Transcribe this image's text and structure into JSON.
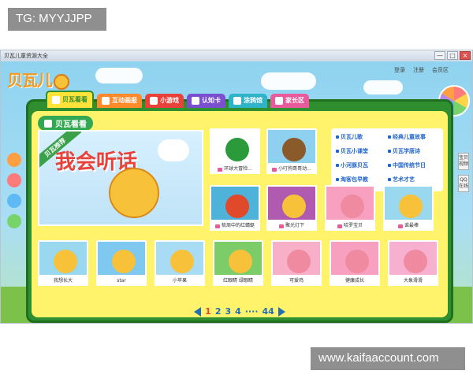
{
  "tags": {
    "top": "TG: MYYJJPP",
    "bottom": "www.kaifaaccount.com"
  },
  "window": {
    "title": "贝瓦儿童资源大全",
    "controls": [
      "—",
      "□",
      "×"
    ]
  },
  "header": {
    "logo_text": "贝瓦儿",
    "links": [
      "登录",
      "注册",
      "会员区"
    ]
  },
  "tabs": [
    {
      "label": "贝瓦看看",
      "color": "#2f8f2f"
    },
    {
      "label": "互动画报",
      "color": "#ff8a2a"
    },
    {
      "label": "小游戏",
      "color": "#e8423a"
    },
    {
      "label": "认知卡",
      "color": "#7a4fd0"
    },
    {
      "label": "涂鸦馆",
      "color": "#2eb3c9"
    },
    {
      "label": "家长区",
      "color": "#e85a9b"
    }
  ],
  "section_title": "贝瓦看看",
  "featured": {
    "ribbon": "贝瓦推荐",
    "headline": "我会听话"
  },
  "links": [
    "贝瓦儿歌",
    "经典儿童故事",
    "贝瓦小课堂",
    "贝瓦学唐诗",
    "小河豚贝瓦",
    "中国传统节日",
    "淘客包早教",
    "艺术才艺"
  ],
  "row1": [
    {
      "caption": "环球大冒险...",
      "bg": "#ffffff",
      "char": "#2a9a3a"
    },
    {
      "caption": "小叮狗哥哥动...",
      "bg": "#8ed0f0",
      "char": "#8b5a2b"
    }
  ],
  "row2": [
    {
      "caption": "梳周中的红蜻蜓",
      "bg": "#4fb3d9",
      "char": "#e04a2a"
    },
    {
      "caption": "聚光灯下",
      "bg": "#b05ab0",
      "char": "#f7c23a"
    },
    {
      "caption": "哈罗宝贝",
      "bg": "#f7a0c0",
      "char": "#f08aa0"
    },
    {
      "caption": "谁最棒",
      "bg": "#9ad8f0",
      "char": "#f7c23a"
    }
  ],
  "row3": [
    {
      "caption": "我想长大",
      "bg": "#9ad8f0",
      "char": "#f7c23a"
    },
    {
      "caption": "star",
      "bg": "#7fc8f0",
      "char": "#f7c23a"
    },
    {
      "caption": "小苹果",
      "bg": "#a8dcf5",
      "char": "#f7c23a"
    },
    {
      "caption": "红眼睛 绿眼睛",
      "bg": "#7ccc6a",
      "char": "#f7c23a"
    },
    {
      "caption": "可爱鸡",
      "bg": "#f7b0c8",
      "char": "#f08aa0"
    },
    {
      "caption": "健康成长",
      "bg": "#f7a0c0",
      "char": "#f08aa0"
    },
    {
      "caption": "大象滑滑",
      "bg": "#f7b0d0",
      "char": "#f08aa0"
    }
  ],
  "pager": {
    "pages": [
      "1",
      "2",
      "3",
      "4"
    ],
    "ellipsis": "····",
    "last": "44",
    "current": "1"
  },
  "side_right": [
    "宝贝视频",
    "QQ在线"
  ]
}
